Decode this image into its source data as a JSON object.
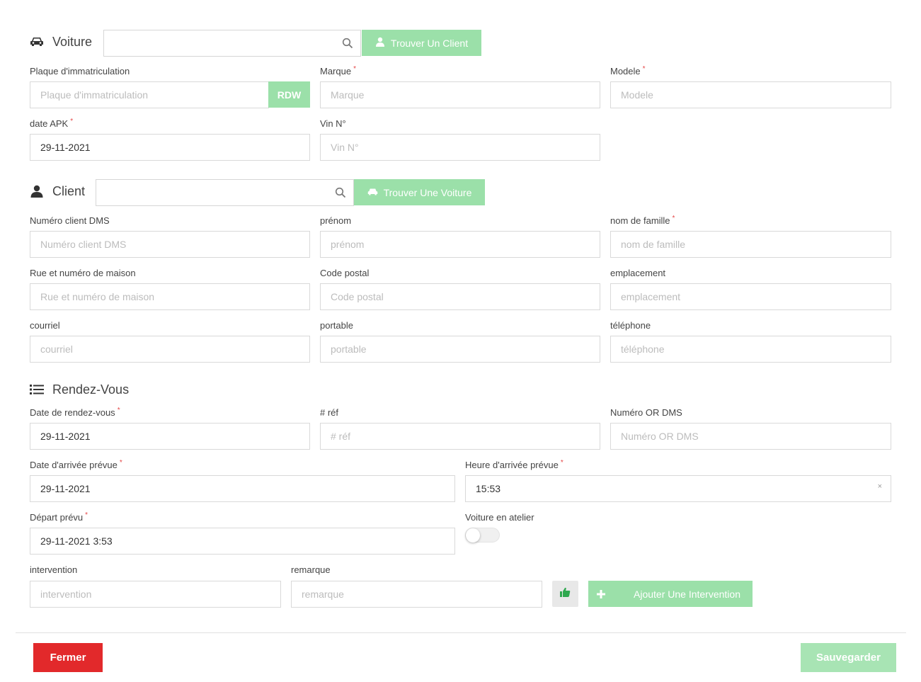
{
  "voiture": {
    "title": "Voiture",
    "icon": "car-icon",
    "search_value": "",
    "find_client_label": "Trouver Un Client",
    "plaque_label": "Plaque d'immatriculation",
    "plaque_placeholder": "Plaque d'immatriculation",
    "rdw_label": "RDW",
    "marque_label": "Marque",
    "marque_placeholder": "Marque",
    "modele_label": "Modele",
    "modele_placeholder": "Modele",
    "date_apk_label": "date APK",
    "date_apk_value": "29-11-2021",
    "vin_label": "Vin N°",
    "vin_placeholder": "Vin N°"
  },
  "client": {
    "title": "Client",
    "icon": "user-icon",
    "search_value": "",
    "find_car_label": "Trouver Une Voiture",
    "numero_label": "Numéro client DMS",
    "numero_placeholder": "Numéro client DMS",
    "prenom_label": "prénom",
    "prenom_placeholder": "prénom",
    "nom_label": "nom de famille",
    "nom_placeholder": "nom de famille",
    "rue_label": "Rue et numéro de maison",
    "rue_placeholder": "Rue et numéro de maison",
    "code_label": "Code postal",
    "code_placeholder": "Code postal",
    "emplacement_label": "emplacement",
    "emplacement_placeholder": "emplacement",
    "courriel_label": "courriel",
    "courriel_placeholder": "courriel",
    "portable_label": "portable",
    "portable_placeholder": "portable",
    "telephone_label": "téléphone",
    "telephone_placeholder": "téléphone"
  },
  "rdv": {
    "title": "Rendez-Vous",
    "icon": "list-icon",
    "date_label": "Date de rendez-vous",
    "date_value": "29-11-2021",
    "ref_label": "# réf",
    "ref_placeholder": "# réf",
    "numero_or_label": "Numéro OR DMS",
    "numero_or_placeholder": "Numéro OR DMS",
    "arrivee_date_label": "Date d'arrivée prévue",
    "arrivee_date_value": "29-11-2021",
    "arrivee_heure_label": "Heure d'arrivée prévue",
    "arrivee_heure_value": "15:53",
    "clear_label": "×",
    "depart_label": "Départ prévu",
    "depart_value": "29-11-2021 3:53",
    "atelier_label": "Voiture en atelier",
    "atelier_on": false,
    "intervention_label": "intervention",
    "intervention_placeholder": "intervention",
    "remarque_label": "remarque",
    "remarque_placeholder": "remarque",
    "add_intervention_label": "Ajouter Une Intervention"
  },
  "footer": {
    "close_label": "Fermer",
    "save_label": "Sauvegarder"
  },
  "colors": {
    "green": "#9be0a9",
    "red": "#e2292b",
    "required": "#e54848"
  }
}
